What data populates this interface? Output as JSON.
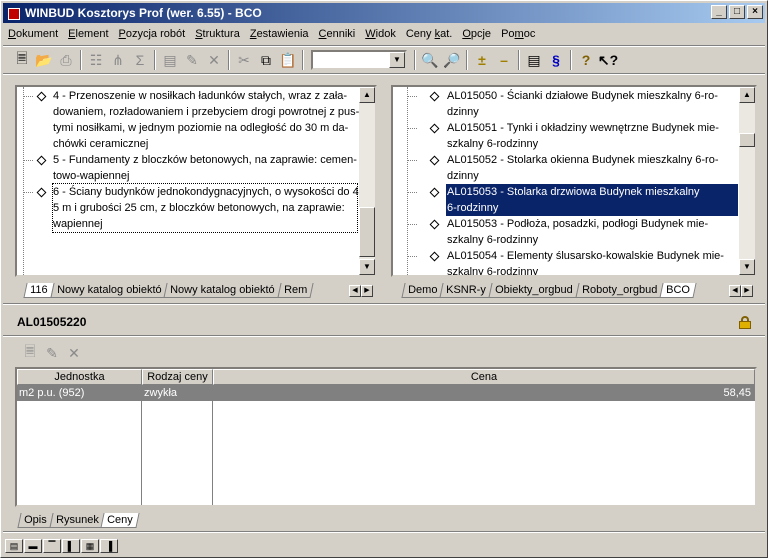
{
  "window": {
    "title": "WINBUD Kosztorys Prof (wer. 6.55) - BCO"
  },
  "menu": [
    {
      "label": "Dokument",
      "key": "D"
    },
    {
      "label": "Element",
      "key": "E"
    },
    {
      "label": "Pozycja robót",
      "key": "P"
    },
    {
      "label": "Struktura",
      "key": "S"
    },
    {
      "label": "Zestawienia",
      "key": "Z"
    },
    {
      "label": "Cenniki",
      "key": "C"
    },
    {
      "label": "Widok",
      "key": "W"
    },
    {
      "label": "Ceny kat.",
      "key": "k"
    },
    {
      "label": "Opcje",
      "key": "O"
    },
    {
      "label": "Pomoc",
      "key": "m"
    }
  ],
  "toolbar": {
    "combo_value": ""
  },
  "left_tree": {
    "items": [
      {
        "lines": [
          "4 - Przenoszenie w nosiłkach ładunków stałych, wraz z zała-",
          "dowaniem, rozładowaniem i przebyciem drogi powrotnej z pus-",
          "tymi nosiłkami, w jednym poziomie na odległość do 30 m da-",
          "chówki ceramicznej"
        ]
      },
      {
        "lines": [
          "5 - Fundamenty z bloczków betonowych, na zaprawie: cemen-",
          "towo-wapiennej"
        ]
      },
      {
        "lines": [
          "6 - Ściany budynków jednokondygnacyjnych, o wysokości do 4,",
          "5 m i grubości 25 cm, z bloczków betonowych, na zaprawie:",
          "wapiennej"
        ]
      }
    ]
  },
  "left_tabs": [
    "116",
    "Nowy katalog obiektó",
    "Nowy katalog obiektó",
    "Rem"
  ],
  "right_tree": {
    "items": [
      {
        "lines": [
          "AL015050 - Ścianki działowe Budynek mieszkalny 6-ro-",
          "dzinny"
        ]
      },
      {
        "lines": [
          "AL015051 - Tynki i okładziny wewnętrzne Budynek mie-",
          "szkalny 6-rodzinny"
        ]
      },
      {
        "lines": [
          "AL015052 - Stolarka okienna Budynek mieszkalny 6-ro-",
          "dzinny"
        ]
      },
      {
        "lines": [
          "AL015053 - Stolarka drzwiowa Budynek mieszkalny",
          "6-rodzinny"
        ]
      },
      {
        "lines": [
          "AL015053 - Podłoża, posadzki, podłogi Budynek mie-",
          "szkalny 6-rodzinny"
        ]
      },
      {
        "lines": [
          "AL015054 - Elementy ślusarsko-kowalskie Budynek mie-",
          "szkalny 6-rodzinny"
        ]
      }
    ]
  },
  "right_tabs": [
    "Demo",
    "KSNR-y",
    "Obiekty_orgbud",
    "Roboty_orgbud",
    "BCO"
  ],
  "detail": {
    "code": "AL01505220",
    "grid": {
      "headers": [
        "Jednostka",
        "Rodzaj ceny",
        "Cena"
      ],
      "rows": [
        {
          "unit": "m2 p.u. (952)",
          "type": "zwykła",
          "price": "58,45"
        }
      ]
    }
  },
  "bottom_tabs": [
    "Opis",
    "Rysunek",
    "Ceny"
  ]
}
